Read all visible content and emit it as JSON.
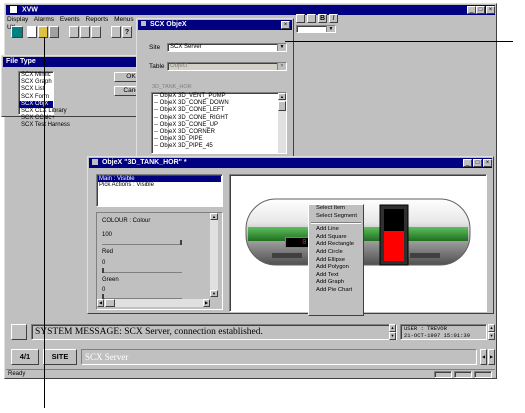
{
  "app": {
    "title": "XVW",
    "menu": [
      "Display",
      "Alarms",
      "Events",
      "Reports",
      "Menus",
      "Utl"
    ],
    "status_ready": "Ready"
  },
  "toolbar": {
    "right_buttons": [
      "B",
      "I"
    ]
  },
  "file_type": {
    "title": "File Type",
    "items": [
      "SCX Mimic",
      "SCX Graph",
      "SCX List",
      "SCX Form",
      "SCX ObjX",
      "SCX CLX Library",
      "SCX CCalc+",
      "SCX Test Harness"
    ],
    "selected_index": 4,
    "ok_label": "OK",
    "cancel_label": "Canc"
  },
  "objex_dialog": {
    "title": "SCX ObjeX",
    "site_label": "Site",
    "site_value": "SCX Server",
    "table_label": "Table",
    "table_value": "Object",
    "list_header": "3D_TANK_HOR",
    "items": [
      "ObjeX 3D_VENT_PUMP",
      "ObjeX 3D_CONE_DOWN",
      "ObjeX 3D_CONE_LEFT",
      "ObjeX 3D_CONE_RIGHT",
      "ObjeX 3D_CONE_UP",
      "ObjeX 3D_CORNER",
      "ObjeX 3D_PIPE",
      "ObjeX 3D_PIPE_45"
    ]
  },
  "objex_editor": {
    "title": "ObjeX \"3D_TANK_HOR\" *",
    "actions": [
      "Main : Visible",
      "Pick Actions : Visible"
    ],
    "properties": {
      "colour_label": "COLOUR : Colour",
      "value_100": "100",
      "red_label": "Red",
      "value_0a": "0",
      "green_label": "Green",
      "value_0b": "0",
      "blue_label": "Blue"
    },
    "tank_readout": "0.00",
    "context_menu": {
      "group1": [
        "Select Item",
        "Select Segment"
      ],
      "group2": [
        "Add Line",
        "Add Square",
        "Add Rectangle",
        "Add Circle",
        "Add Ellipse",
        "Add Polygon",
        "Add Text",
        "Add Graph",
        "Add Pie Chart"
      ]
    }
  },
  "system_bar": {
    "message": "SYSTEM MESSAGE: SCX Server, connection established.",
    "user_line": "USER : TREVOR",
    "date_line": "21-OCT-1997 15:01:39",
    "page_label": "4/1",
    "site_label": "SITE",
    "server_label": "SCX Server"
  },
  "colors": {
    "titlebar": "#000080",
    "tank_green": "#2e8b2e",
    "tank_red": "#ff0000",
    "readout_red": "#ff2020"
  }
}
